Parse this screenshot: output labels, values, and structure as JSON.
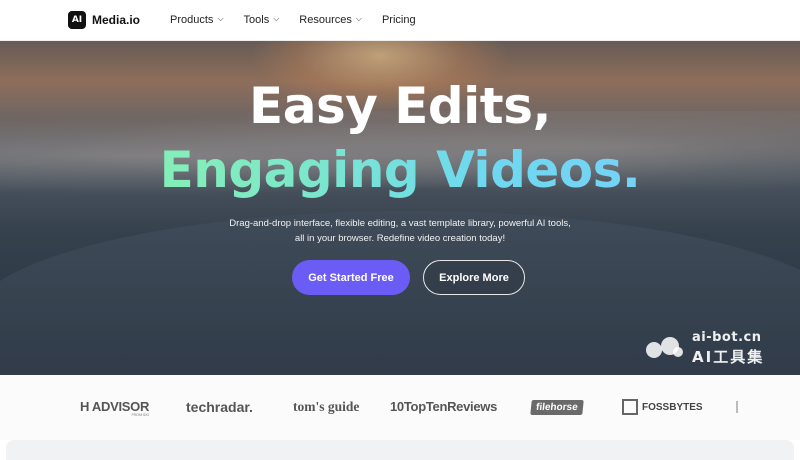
{
  "header": {
    "logo_mark": "AI",
    "brand": "Media.io",
    "nav": [
      {
        "label": "Products",
        "has_dropdown": true
      },
      {
        "label": "Tools",
        "has_dropdown": true
      },
      {
        "label": "Resources",
        "has_dropdown": true
      },
      {
        "label": "Pricing",
        "has_dropdown": false
      }
    ]
  },
  "hero": {
    "title_line1": "Easy Edits,",
    "title_line2": "Engaging Videos.",
    "subtitle": "Drag-and-drop interface, flexible editing, a vast template library, powerful AI tools, all in your browser. Redefine video creation today!",
    "cta_primary": "Get Started Free",
    "cta_secondary": "Explore More",
    "colors": {
      "primary_button": "#6c5cf6",
      "gradient_start": "#8ef5a6",
      "gradient_end": "#7ecbff"
    }
  },
  "watermark": {
    "top": "ai-bot.cn",
    "bottom": "AI工具集"
  },
  "press_logos": {
    "b1_main": "H ADVISOR",
    "b1_sub": "FROM IDG",
    "b2": "techradar.",
    "b3": "tom's guide",
    "b4_num": "10",
    "b4_text": "TopTenReviews",
    "b5": "filehorse",
    "b6": "FOSSBYTES"
  }
}
